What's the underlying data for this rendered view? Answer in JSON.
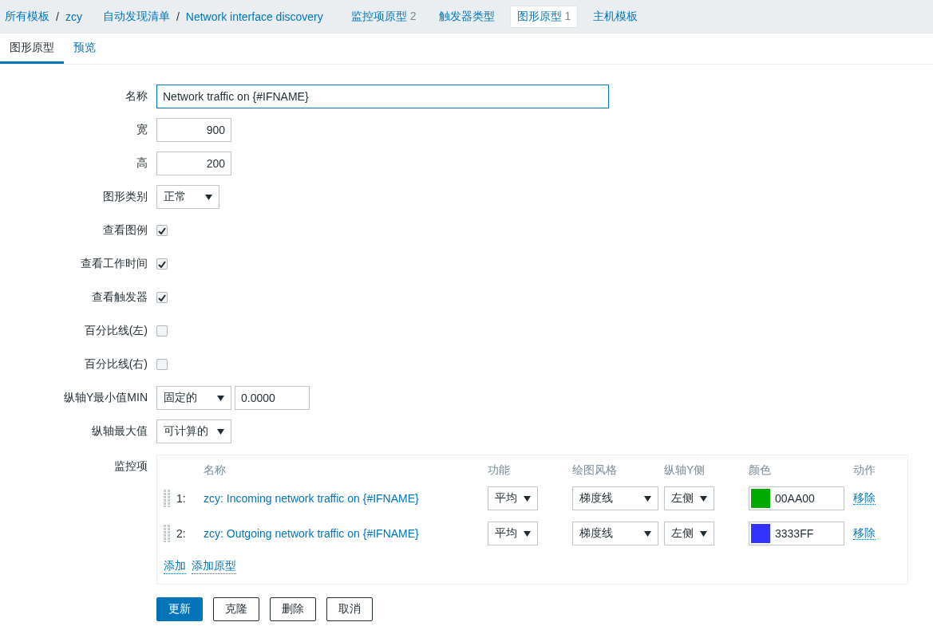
{
  "nav": [
    {
      "kind": "path",
      "separator": "/",
      "parts": [
        "所有模板",
        "zcy"
      ]
    },
    {
      "kind": "path",
      "separator": "/",
      "parts": [
        "自动发现清单",
        "Network interface discovery"
      ]
    },
    {
      "kind": "tab",
      "label": "监控项原型",
      "count": "2",
      "selected": false
    },
    {
      "kind": "tab",
      "label": "触发器类型",
      "selected": false
    },
    {
      "kind": "tab",
      "label": "图形原型",
      "count": "1",
      "selected": true
    },
    {
      "kind": "tab",
      "label": "主机模板",
      "selected": false
    }
  ],
  "subtabs": [
    {
      "label": "图形原型",
      "selected": true
    },
    {
      "label": "预览",
      "selected": false
    }
  ],
  "fields": [
    {
      "kind": "text",
      "label": "名称",
      "value": "Network traffic on {#IFNAME}"
    },
    {
      "kind": "number",
      "label": "宽",
      "value": "900"
    },
    {
      "kind": "number",
      "label": "高",
      "value": "200"
    },
    {
      "kind": "select",
      "label": "图形类别",
      "value": "正常"
    },
    {
      "kind": "checkbox",
      "label": "查看图例",
      "checked": true
    },
    {
      "kind": "checkbox",
      "label": "查看工作时间",
      "checked": true
    },
    {
      "kind": "checkbox",
      "label": "查看触发器",
      "checked": true
    },
    {
      "kind": "checkbox",
      "label": "百分比线(左)",
      "checked": false
    },
    {
      "kind": "checkbox",
      "label": "百分比线(右)",
      "checked": false
    },
    {
      "kind": "select_input",
      "label": "纵轴Y最小值MIN",
      "value": "固定的",
      "input": "0.0000"
    },
    {
      "kind": "select",
      "label": "纵轴最大值",
      "value": "可计算的"
    }
  ],
  "items": {
    "label": "监控项",
    "columns": [
      "名称",
      "功能",
      "绘图风格",
      "纵轴Y侧",
      "颜色",
      "动作"
    ],
    "rows": [
      {
        "index": "1:",
        "name": "zcy: Incoming network traffic on {#IFNAME}",
        "function": "平均",
        "style": "梯度线",
        "axis": "左侧",
        "color": "#00aa00",
        "color_code": "00AA00",
        "action": "移除"
      },
      {
        "index": "2:",
        "name": "zcy: Outgoing network traffic on {#IFNAME}",
        "function": "平均",
        "style": "梯度线",
        "axis": "左侧",
        "color": "#3333ff",
        "color_code": "3333FF",
        "action": "移除"
      }
    ],
    "links": [
      "添加",
      "添加原型"
    ]
  },
  "buttons": [
    {
      "label": "更新",
      "primary": true
    },
    {
      "label": "克隆",
      "primary": false
    },
    {
      "label": "删除",
      "primary": false
    },
    {
      "label": "取消",
      "primary": false
    }
  ]
}
